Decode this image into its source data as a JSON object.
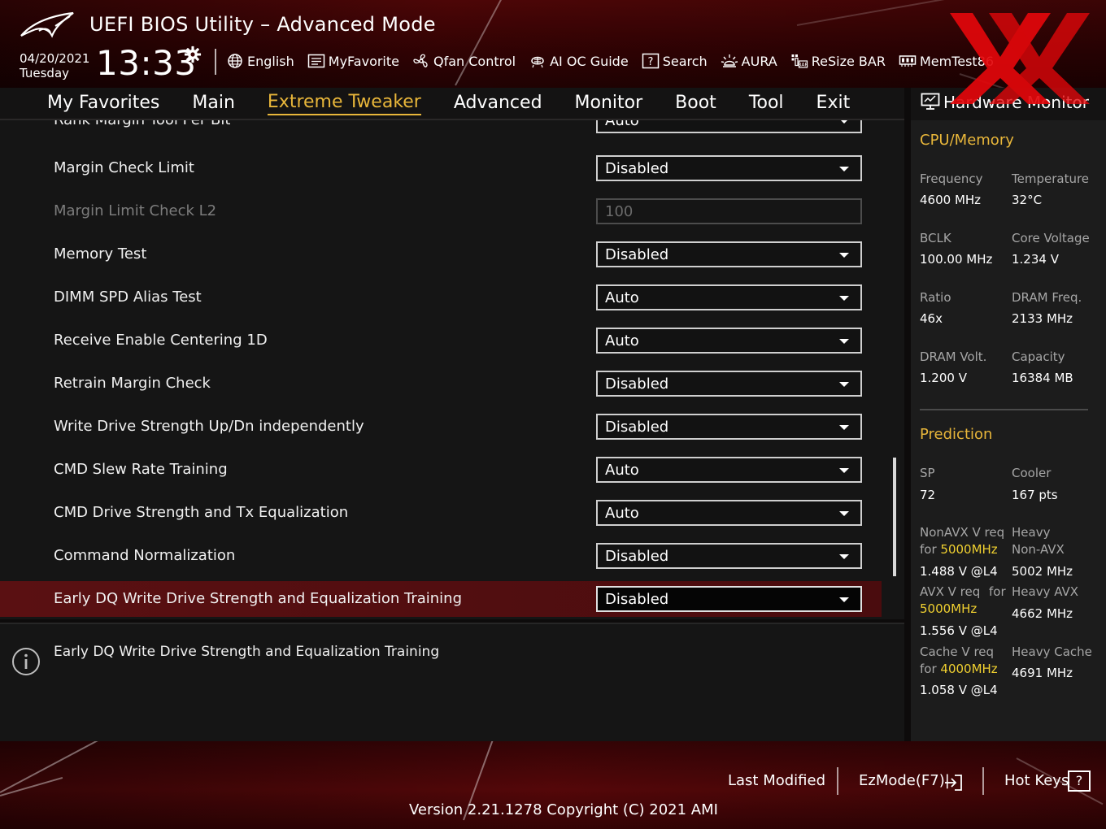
{
  "header": {
    "title": "UEFI BIOS Utility – Advanced Mode",
    "date": "04/20/2021",
    "day": "Tuesday",
    "time": "13:33",
    "toolbar": [
      {
        "label": "English",
        "icon": "globe-icon"
      },
      {
        "label": "MyFavorite",
        "icon": "favorite-list-icon"
      },
      {
        "label": "Qfan Control",
        "icon": "fan-icon"
      },
      {
        "label": "AI OC Guide",
        "icon": "ai-guide-icon"
      },
      {
        "label": "Search",
        "icon": "search-help-icon"
      },
      {
        "label": "AURA",
        "icon": "aura-light-icon"
      },
      {
        "label": "ReSize BAR",
        "icon": "resize-bar-icon"
      },
      {
        "label": "MemTest86",
        "icon": "memory-icon"
      }
    ]
  },
  "nav": {
    "tabs": [
      {
        "label": "My Favorites",
        "active": false
      },
      {
        "label": "Main",
        "active": false
      },
      {
        "label": "Extreme Tweaker",
        "active": true
      },
      {
        "label": "Advanced",
        "active": false
      },
      {
        "label": "Monitor",
        "active": false
      },
      {
        "label": "Boot",
        "active": false
      },
      {
        "label": "Tool",
        "active": false
      },
      {
        "label": "Exit",
        "active": false
      }
    ]
  },
  "settings": [
    {
      "label": "Rank Margin Tool Per Bit",
      "value": "Auto",
      "type": "select"
    },
    {
      "label": "Margin Check Limit",
      "value": "Disabled",
      "type": "select"
    },
    {
      "label": "Margin Limit Check L2",
      "value": "100",
      "type": "field",
      "disabled": true
    },
    {
      "label": "Memory Test",
      "value": "Disabled",
      "type": "select"
    },
    {
      "label": "DIMM SPD Alias Test",
      "value": "Auto",
      "type": "select"
    },
    {
      "label": "Receive Enable Centering 1D",
      "value": "Auto",
      "type": "select"
    },
    {
      "label": "Retrain Margin Check",
      "value": "Disabled",
      "type": "select"
    },
    {
      "label": "Write Drive Strength Up/Dn independently",
      "value": "Disabled",
      "type": "select"
    },
    {
      "label": "CMD Slew Rate Training",
      "value": "Auto",
      "type": "select"
    },
    {
      "label": "CMD Drive Strength and Tx Equalization",
      "value": "Auto",
      "type": "select"
    },
    {
      "label": "Command Normalization",
      "value": "Disabled",
      "type": "select"
    },
    {
      "label": "Early DQ Write Drive Strength and Equalization Training",
      "value": "Disabled",
      "type": "select",
      "selected": true
    }
  ],
  "help": {
    "text": "Early DQ Write Drive Strength and Equalization Training"
  },
  "hw_monitor": {
    "title": "Hardware Monitor",
    "cpu_memory": {
      "title": "CPU/Memory",
      "frequency_label": "Frequency",
      "frequency_value": "4600 MHz",
      "temperature_label": "Temperature",
      "temperature_value": "32°C",
      "bclk_label": "BCLK",
      "bclk_value": "100.00 MHz",
      "core_voltage_label": "Core Voltage",
      "core_voltage_value": "1.234 V",
      "ratio_label": "Ratio",
      "ratio_value": "46x",
      "dram_freq_label": "DRAM Freq.",
      "dram_freq_value": "2133 MHz",
      "dram_volt_label": "DRAM Volt.",
      "dram_volt_value": "1.200 V",
      "capacity_label": "Capacity",
      "capacity_value": "16384 MB"
    },
    "prediction": {
      "title": "Prediction",
      "sp_label": "SP",
      "sp_value": "72",
      "cooler_label": "Cooler",
      "cooler_value": "167 pts",
      "nonavx_req_label": "NonAVX V req",
      "nonavx_for": "for",
      "nonavx_freq": "5000MHz",
      "nonavx_value": "1.488 V @L4",
      "heavy_nonavx_label1": "Heavy",
      "heavy_nonavx_label2": "Non-AVX",
      "heavy_nonavx_value": "5002 MHz",
      "avx_req_label": "AVX V req",
      "avx_for": "for",
      "avx_freq": "5000MHz",
      "avx_value": "1.556 V @L4",
      "heavy_avx_label": "Heavy AVX",
      "heavy_avx_value": "4662 MHz",
      "cache_req_label": "Cache V req",
      "cache_for": "for",
      "cache_freq": "4000MHz",
      "cache_value": "1.058 V @L4",
      "heavy_cache_label": "Heavy Cache",
      "heavy_cache_value": "4691 MHz"
    }
  },
  "footer": {
    "last_modified": "Last Modified",
    "ezmode": "EzMode(F7)|",
    "hot_keys": "Hot Keys",
    "hot_keys_key": "?",
    "version": "Version 2.21.1278 Copyright (C) 2021 AMI"
  },
  "colors": {
    "accent": "#e8b63a",
    "highlight_yellow": "#f0d030",
    "selected_row": "#5a1012",
    "header_red": "#4a0506"
  }
}
